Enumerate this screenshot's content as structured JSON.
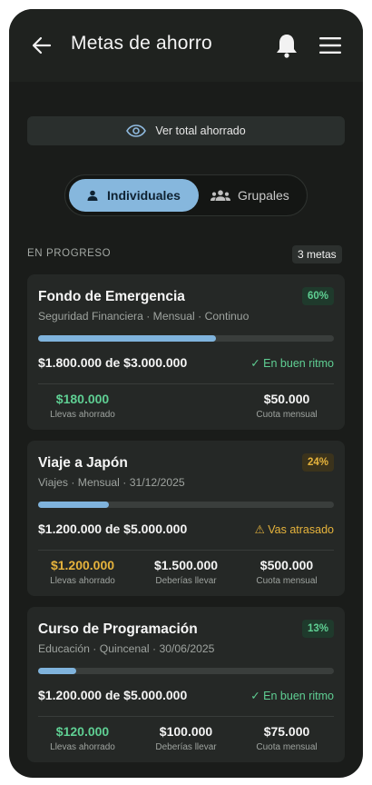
{
  "header": {
    "title": "Metas de ahorro",
    "back_icon": "arrow-left-icon",
    "bell_icon": "bell-icon",
    "menu_icon": "hamburger-menu-icon"
  },
  "reveal_total": {
    "label": "Ver total ahorrado",
    "icon": "eye-icon"
  },
  "tabs": {
    "active": {
      "label": "Individuales",
      "icon": "person-icon"
    },
    "inactive": {
      "label": "Grupales",
      "icon": "group-icon"
    }
  },
  "section": {
    "label": "EN PROGRESO",
    "count": "3 metas"
  },
  "colors": {
    "accent": "#86b7dd",
    "green": "#5fcf93",
    "amber": "#e6b33c",
    "background": "#1a1c1a"
  },
  "goals": [
    {
      "title": "Fondo de Emergencia",
      "subtitle": "Seguridad Financiera · Mensual · Continuo",
      "percent": "60%",
      "progress": 0.6,
      "amounts": "$1.800.000 de $3.000.000",
      "status": "✓ En buen ritmo",
      "status_tone": "green",
      "stats": [
        {
          "value": "$180.000",
          "label": "Llevas ahorrado",
          "tone": "green"
        },
        {
          "value": "$50.000",
          "label": "Cuota mensual",
          "tone": "white"
        }
      ]
    },
    {
      "title": "Viaje a Japón",
      "subtitle": "Viajes · Mensual · 31/12/2025",
      "percent": "24%",
      "progress": 0.24,
      "amounts": "$1.200.000 de $5.000.000",
      "status": "⚠ Vas atrasado",
      "status_tone": "amber",
      "stats": [
        {
          "value": "$1.200.000",
          "label": "Llevas ahorrado",
          "tone": "amber"
        },
        {
          "value": "$1.500.000",
          "label": "Deberías llevar",
          "tone": "white"
        },
        {
          "value": "$500.000",
          "label": "Cuota mensual",
          "tone": "white"
        }
      ]
    },
    {
      "title": "Curso de Programación",
      "subtitle": "Educación · Quincenal · 30/06/2025",
      "percent": "13%",
      "progress": 0.13,
      "amounts": "$1.200.000 de $5.000.000",
      "status": "✓ En buen ritmo",
      "status_tone": "green",
      "stats": [
        {
          "value": "$120.000",
          "label": "Llevas ahorrado",
          "tone": "green"
        },
        {
          "value": "$100.000",
          "label": "Deberías llevar",
          "tone": "white"
        },
        {
          "value": "$75.000",
          "label": "Cuota mensual",
          "tone": "white"
        }
      ]
    }
  ]
}
